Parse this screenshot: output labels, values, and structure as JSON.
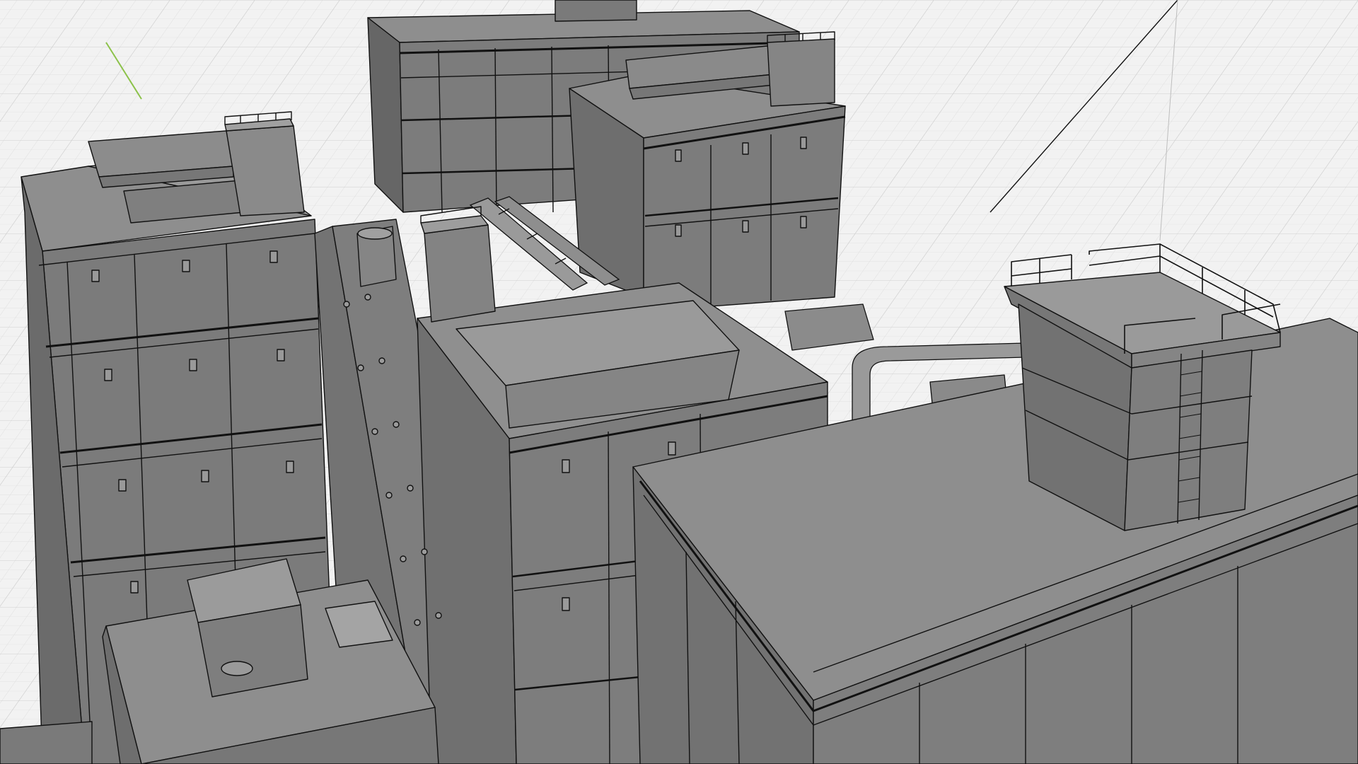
{
  "viewport": {
    "name": "3d-perspective-viewport",
    "background": "#f2f2f2",
    "grid_minor": "#dcdcdc",
    "grid_major": "#c8c8c8",
    "axis_green": "#8cc24a",
    "ink": "#111111",
    "fill_roof": "#8e8e8e",
    "fill_wall": "#7d7d7d",
    "fill_wall_dark": "#6f6f6f",
    "fill_top": "#a1a1a1"
  },
  "scene": {
    "objects": [
      "left-tall-building",
      "center-back-building",
      "right-back-tower",
      "center-front-building",
      "bottom-left-low-building",
      "right-large-building",
      "roof-stair-tower-with-railing",
      "roof-ducts",
      "roof-pipes"
    ]
  }
}
